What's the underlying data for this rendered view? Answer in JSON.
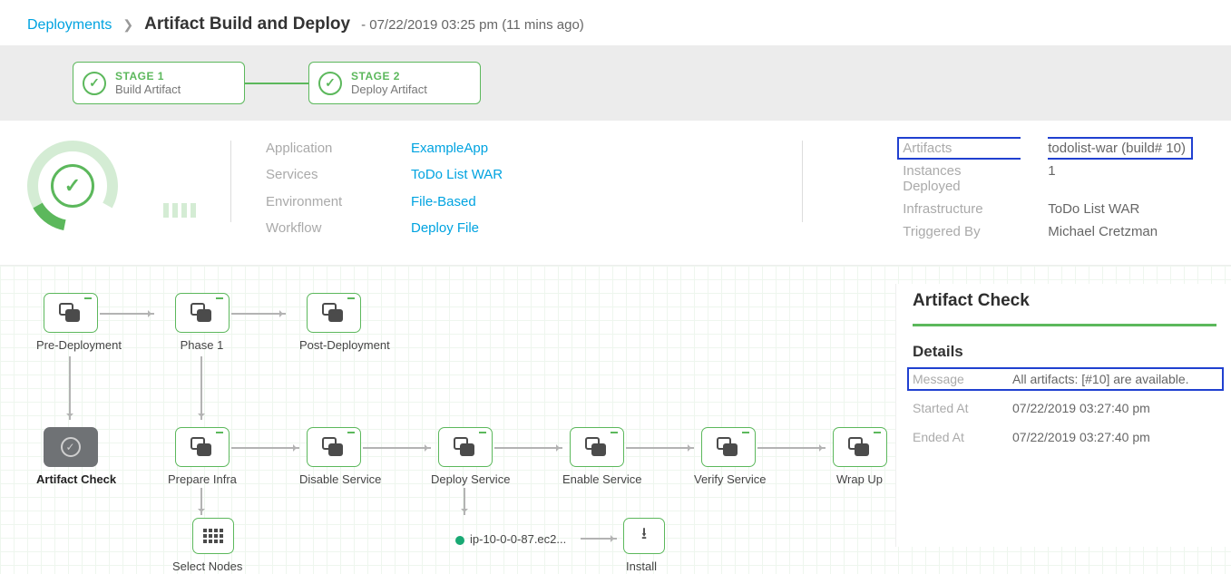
{
  "breadcrumb": {
    "root": "Deployments",
    "title": "Artifact Build and Deploy",
    "timestamp": "- 07/22/2019 03:25 pm (11 mins ago)"
  },
  "stages": [
    {
      "num": "STAGE 1",
      "name": "Build Artifact"
    },
    {
      "num": "STAGE 2",
      "name": "Deploy Artifact"
    }
  ],
  "summary_left": {
    "application_k": "Application",
    "application_v": "ExampleApp",
    "services_k": "Services",
    "services_v": "ToDo List WAR",
    "environment_k": "Environment",
    "environment_v": "File-Based",
    "workflow_k": "Workflow",
    "workflow_v": "Deploy File"
  },
  "summary_right": {
    "artifacts_k": "Artifacts",
    "artifacts_v": "todolist-war (build# 10)",
    "instances_k": "Instances Deployed",
    "instances_v": "1",
    "infra_k": "Infrastructure",
    "infra_v": "ToDo List WAR",
    "trigger_k": "Triggered By",
    "trigger_v": "Michael Cretzman"
  },
  "nodes": {
    "pre": "Pre-Deployment",
    "phase1": "Phase 1",
    "post": "Post-Deployment",
    "artifact": "Artifact Check",
    "prepare": "Prepare Infra",
    "disable": "Disable Service",
    "deploy": "Deploy Service",
    "enable": "Enable Service",
    "verify": "Verify Service",
    "wrap": "Wrap Up",
    "select": "Select Nodes",
    "install": "Install",
    "ip": "ip-10-0-0-87.ec2..."
  },
  "panel": {
    "title": "Artifact Check",
    "section": "Details",
    "message_k": "Message",
    "message_v": "All artifacts: [#10] are available.",
    "started_k": "Started At",
    "started_v": "07/22/2019 03:27:40 pm",
    "ended_k": "Ended At",
    "ended_v": "07/22/2019 03:27:40 pm"
  }
}
